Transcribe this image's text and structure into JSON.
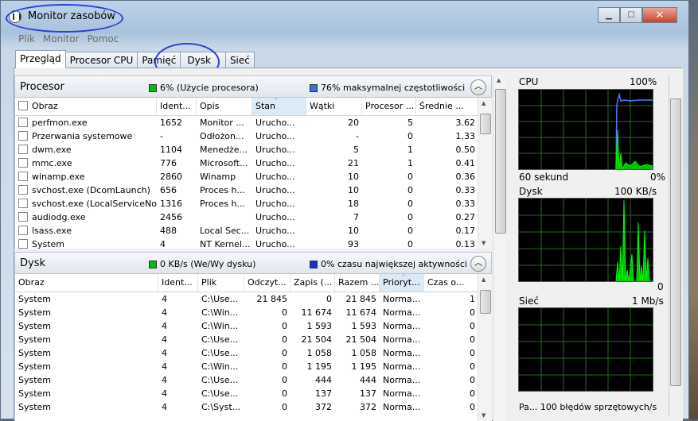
{
  "window": {
    "title": "Monitor zasobów"
  },
  "menu": [
    "Plik",
    "Monitor",
    "Pomoc"
  ],
  "tabs": [
    "Przegląd",
    "Procesor CPU",
    "Pamięć",
    "Dysk",
    "Sieć"
  ],
  "active_tab": "Przegląd",
  "cpu_section": {
    "title": "Procesor",
    "legend_usage": "6% (Użycie procesora)",
    "legend_usage_color": "#00c000",
    "legend_freq": "76% maksymalnej częstotliwości",
    "legend_freq_color": "#3b6fe0",
    "columns": [
      "Obraz",
      "Ident...",
      "Opis",
      "Stan",
      "Wątki",
      "Procesor ...",
      "Średnie ..."
    ],
    "sorted_column": "Stan",
    "rows": [
      [
        "perfmon.exe",
        "1652",
        "Monitor ...",
        "Urucho...",
        "20",
        "5",
        "3.62"
      ],
      [
        "Przerwania systemowe",
        "-",
        "Odłożon...",
        "Urucho...",
        "-",
        "0",
        "1.33"
      ],
      [
        "dwm.exe",
        "1104",
        "Menedże...",
        "Urucho...",
        "5",
        "1",
        "0.50"
      ],
      [
        "mmc.exe",
        "776",
        "Microsoft...",
        "Urucho...",
        "21",
        "1",
        "0.41"
      ],
      [
        "winamp.exe",
        "2860",
        "Winamp",
        "Urucho...",
        "10",
        "0",
        "0.36"
      ],
      [
        "svchost.exe (DcomLaunch)",
        "656",
        "Proces h...",
        "Urucho...",
        "10",
        "0",
        "0.33"
      ],
      [
        "svchost.exe (LocalServiceNo...",
        "1316",
        "Proces h...",
        "Urucho...",
        "18",
        "0",
        "0.33"
      ],
      [
        "audiodg.exe",
        "2456",
        "",
        "Urucho...",
        "7",
        "0",
        "0.27"
      ],
      [
        "lsass.exe",
        "488",
        "Local Sec...",
        "Urucho...",
        "10",
        "0",
        "0.17"
      ],
      [
        "System",
        "4",
        "NT Kernel...",
        "Urucho...",
        "93",
        "0",
        "0.13"
      ]
    ]
  },
  "disk_section": {
    "title": "Dysk",
    "legend_io": "0 KB/s (We/Wy dysku)",
    "legend_io_color": "#00c000",
    "legend_active": "0% czasu największej aktywności",
    "legend_active_color": "#1c2fd0",
    "columns": [
      "Obraz",
      "Ident...",
      "Plik",
      "Odczyt...",
      "Zapis (...",
      "Razem ...",
      "Prioryt...",
      "Czas o..."
    ],
    "sorted_column": "Prioryt...",
    "rows": [
      [
        "System",
        "4",
        "C:\\Use...",
        "21 845",
        "0",
        "21 845",
        "Norma...",
        "1"
      ],
      [
        "System",
        "4",
        "C:\\Win...",
        "0",
        "11 674",
        "11 674",
        "Norma...",
        "0"
      ],
      [
        "System",
        "4",
        "C:\\Win...",
        "0",
        "1 593",
        "1 593",
        "Norma...",
        "0"
      ],
      [
        "System",
        "4",
        "C:\\Use...",
        "0",
        "21 504",
        "21 504",
        "Norma...",
        "0"
      ],
      [
        "System",
        "4",
        "C:\\Use...",
        "0",
        "1 058",
        "1 058",
        "Norma...",
        "0"
      ],
      [
        "System",
        "4",
        "C:\\Win...",
        "0",
        "1 195",
        "1 195",
        "Norma...",
        "0"
      ],
      [
        "System",
        "4",
        "C:\\Use...",
        "0",
        "444",
        "444",
        "Norma...",
        "0"
      ],
      [
        "System",
        "4",
        "C:\\Use...",
        "0",
        "137",
        "137",
        "Norma...",
        "0"
      ],
      [
        "System",
        "4",
        "C:\\Syst...",
        "0",
        "372",
        "372",
        "Norma...",
        "0"
      ]
    ]
  },
  "graphs": {
    "cpu": {
      "label": "CPU",
      "max": "100%",
      "footer_left": "60 sekund",
      "footer_right": "0%"
    },
    "disk": {
      "label": "Dysk",
      "max": "100 KB/s",
      "footer_right": "0"
    },
    "net": {
      "label": "Sieć",
      "max": "1 Mb/s",
      "footer_left": "Pa... 100 błędów sprzętowych/s"
    }
  }
}
